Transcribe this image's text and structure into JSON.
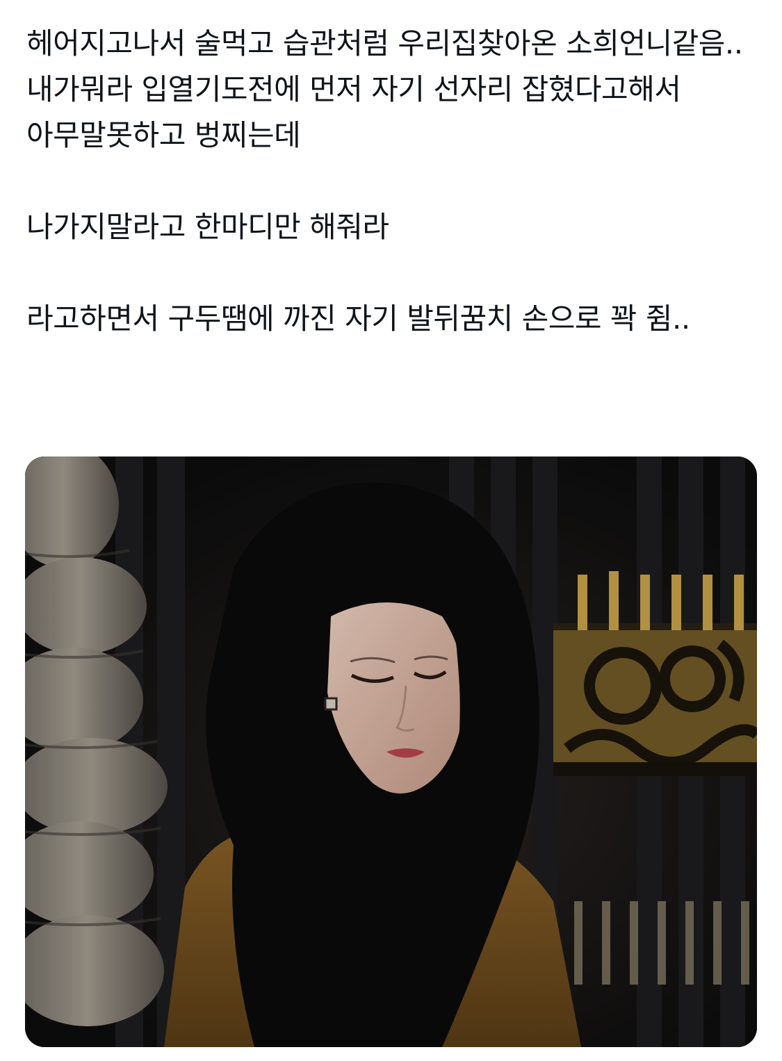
{
  "post": {
    "paragraphs": [
      "헤어지고나서 술먹고 습관처럼 우리집찾아온 소희언니같음.. 내가뭐라 입열기도전에 먼저 자기 선자리 잡혔다고해서 아무말못하고 벙찌는데",
      "나가지말라고 한마디만 해줘라",
      "라고하면서 구두땜에 까진 자기 발뒤꿈치 손으로 꽉 쥠.."
    ]
  },
  "media": {
    "kind": "photo",
    "palette": {
      "background": "#121212",
      "hair": "#0b0a0a",
      "skin": "#e2bfae",
      "lips": "#b8474f",
      "coat": "#7d5724",
      "gold": "#b4923a",
      "stone": "#8f887d"
    }
  }
}
